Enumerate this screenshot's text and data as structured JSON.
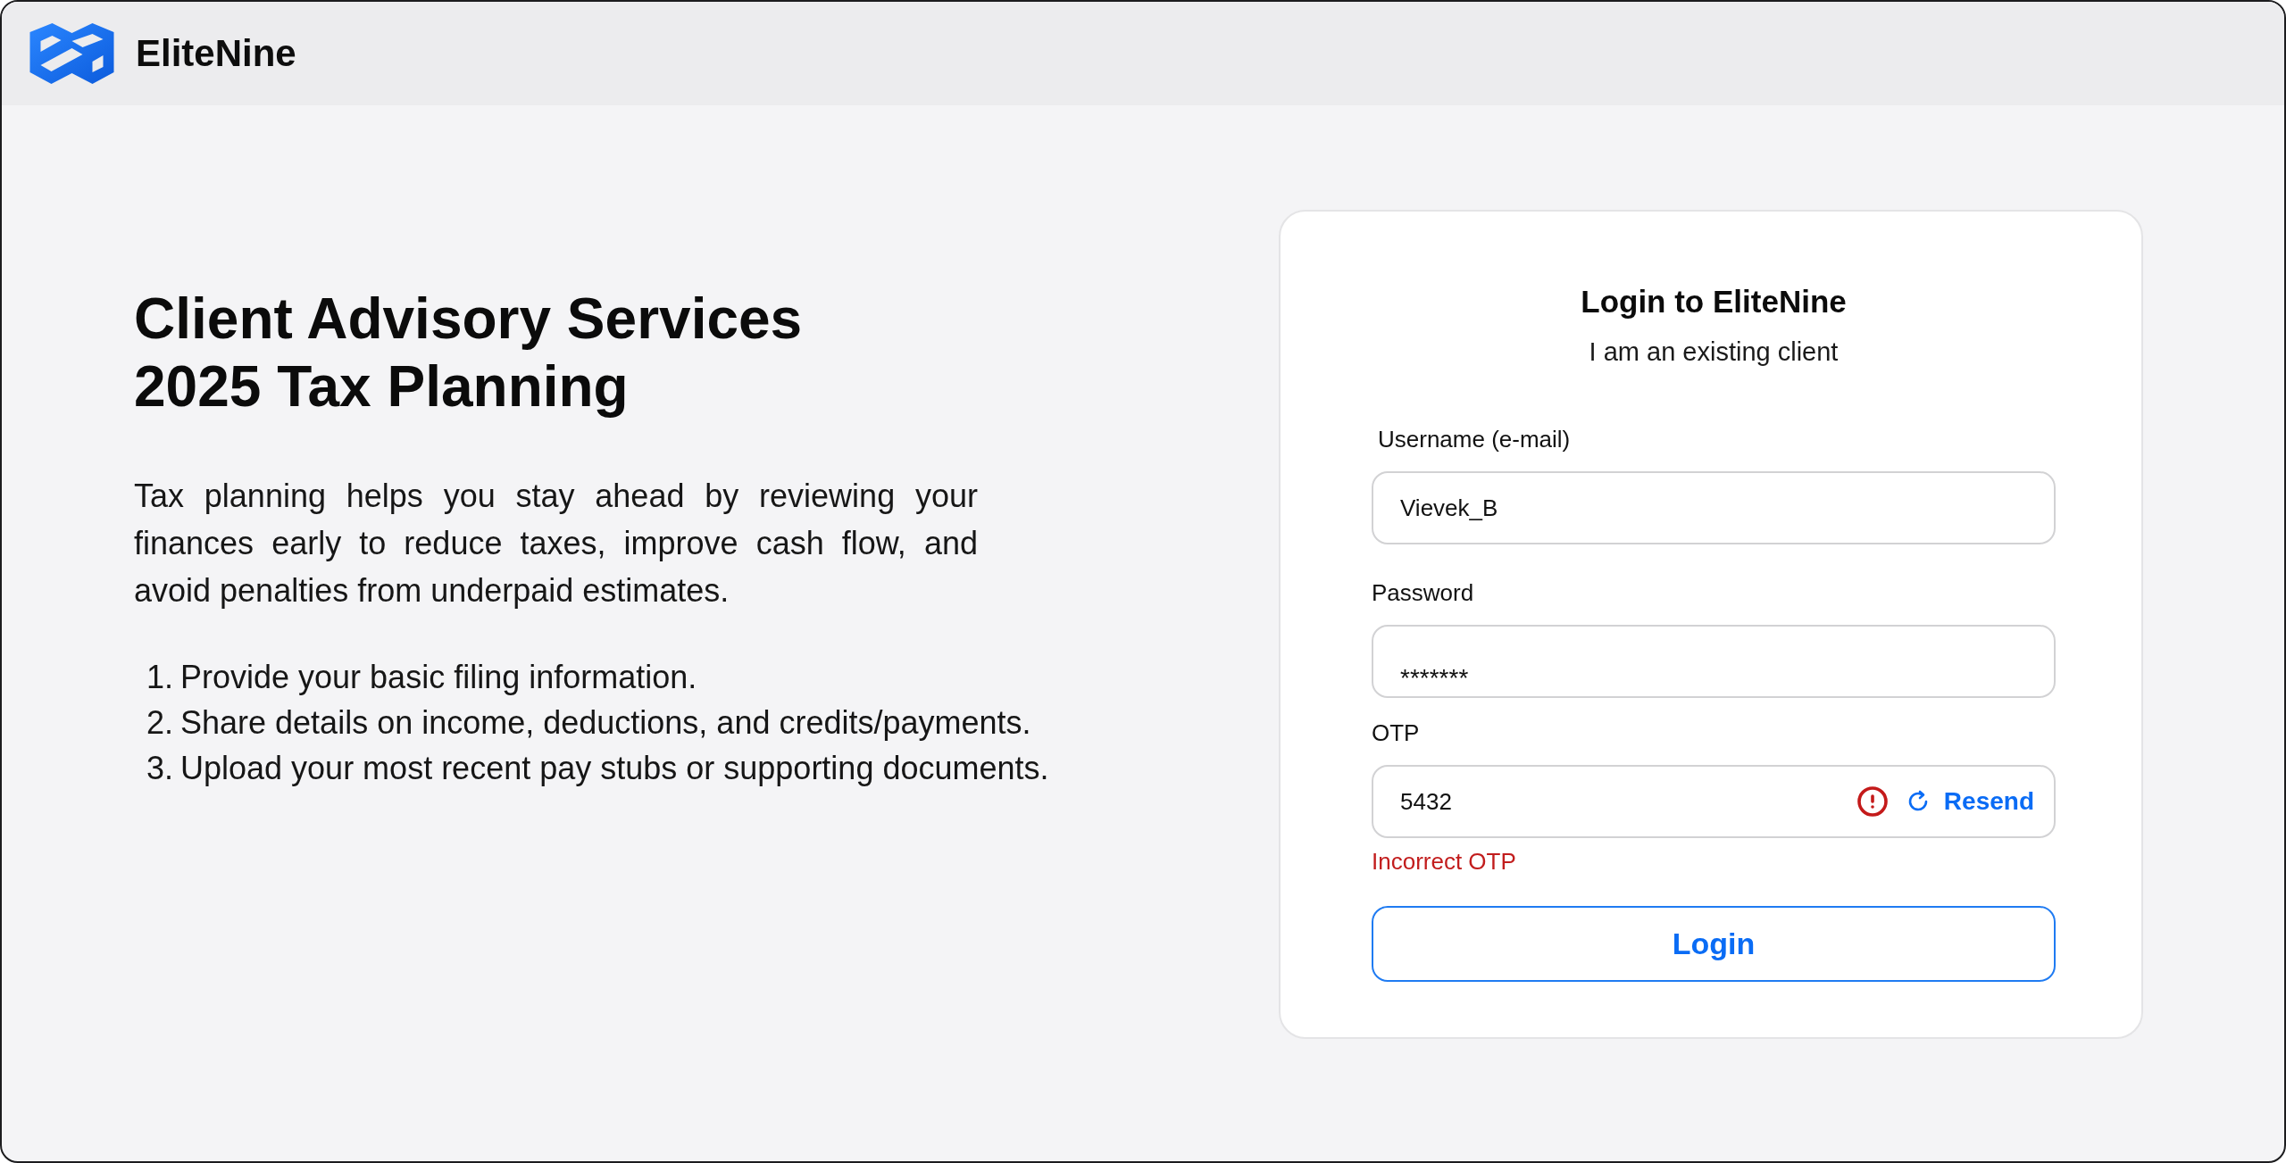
{
  "header": {
    "brand": "EliteNine"
  },
  "intro": {
    "heading_lines": [
      "Client Advisory Services",
      "2025 Tax Planning"
    ],
    "paragraph": "Tax planning helps you stay ahead by reviewing your finances early to reduce taxes, improve cash flow, and avoid penalties from underpaid estimates.",
    "steps": [
      {
        "number": "1.",
        "text": "Provide your basic filing information."
      },
      {
        "number": "2.",
        "text": "Share details on income, deductions, and credits/payments."
      },
      {
        "number": "3.",
        "text": "Upload your most recent pay stubs or supporting documents."
      }
    ]
  },
  "login": {
    "title": "Login to EliteNine",
    "subtitle": "I am an existing client",
    "fields": [
      {
        "kind": "text",
        "label": "Username (e-mail)",
        "value": "Vievek_B",
        "invalid": false
      },
      {
        "kind": "password",
        "label": "Password",
        "value": "*******",
        "invalid": false
      },
      {
        "kind": "otp",
        "label": "OTP",
        "value": "5432",
        "invalid": true,
        "action": "Resend",
        "error_message": "Incorrect OTP"
      }
    ],
    "submit": "Login"
  }
}
